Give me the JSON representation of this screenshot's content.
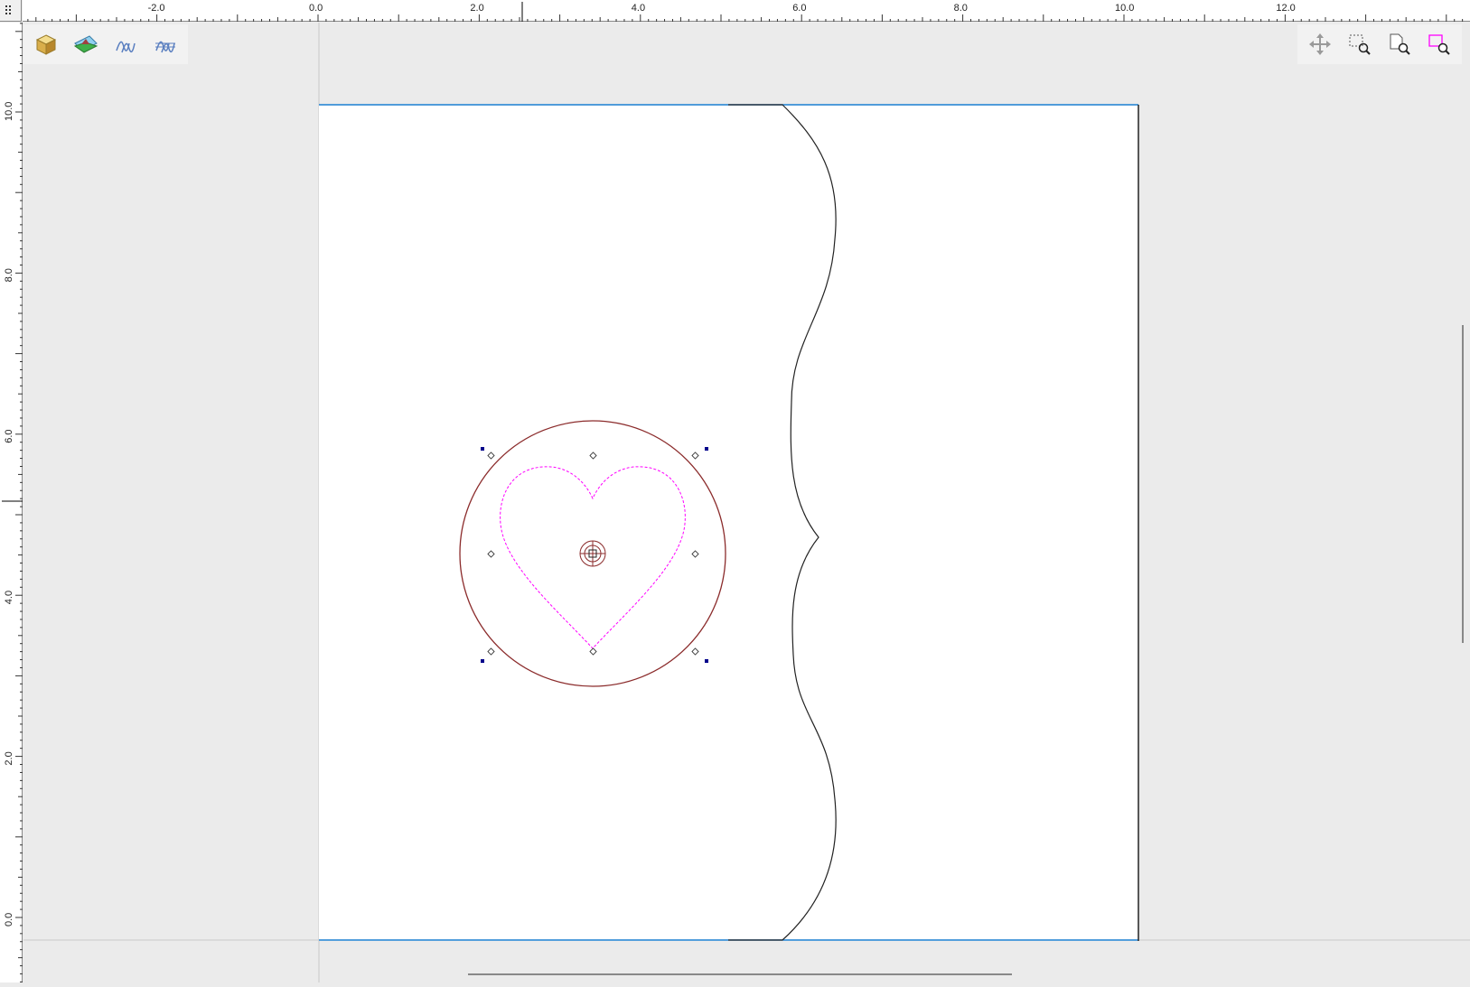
{
  "rulers": {
    "horizontal_labels": [
      "-2.0",
      "0.0",
      "2.0",
      "4.0",
      "6.0",
      "8.0",
      "10.0",
      "12.0"
    ],
    "vertical_labels": [
      "10.0",
      "8.0",
      "6.0",
      "4.0",
      "2.0",
      "0.0"
    ]
  },
  "toolbar_left": [
    {
      "name": "3d-view-button",
      "icon": "cube-icon"
    },
    {
      "name": "render-view-button",
      "icon": "landscape-icon"
    },
    {
      "name": "toolpath-button",
      "icon": "toolpath-icon"
    },
    {
      "name": "toolpath-preview-button",
      "icon": "toolpath-grid-icon"
    }
  ],
  "toolbar_right": [
    {
      "name": "pan-button",
      "icon": "move-arrows-icon"
    },
    {
      "name": "zoom-box-button",
      "icon": "zoom-box-icon"
    },
    {
      "name": "zoom-page-button",
      "icon": "zoom-page-icon"
    },
    {
      "name": "zoom-selection-button",
      "icon": "zoom-selection-icon"
    }
  ],
  "colors": {
    "selected_circle": "#8b2b2b",
    "heart_dashed": "#ff00ff",
    "page_top_line": "#1a7fd1",
    "handle": "#00008b",
    "wavy_line": "#222222"
  }
}
